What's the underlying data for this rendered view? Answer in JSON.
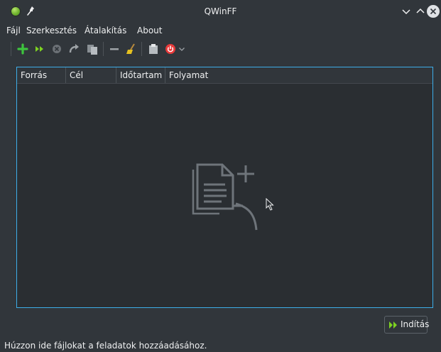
{
  "window": {
    "title": "QWinFF"
  },
  "menu": {
    "items": [
      {
        "label": "Fájl"
      },
      {
        "label": "Szerkesztés"
      },
      {
        "label": "Átalakítás"
      },
      {
        "label": "About"
      }
    ]
  },
  "toolbar": {
    "icons": [
      "add-file-icon",
      "fast-forward-icon",
      "cancel-icon",
      "redo-icon",
      "copy-icon",
      "remove-icon",
      "clear-list-icon",
      "paste-icon",
      "power-icon",
      "chevron-down-icon"
    ]
  },
  "tasklist": {
    "columns": [
      "Forrás",
      "Cél",
      "Időtartam",
      "Folyamat"
    ],
    "empty_icon": "drop-files-icon"
  },
  "actions": {
    "start_label": "Indítás"
  },
  "status": {
    "text": "Húzzon ide fájlokat a feladatok hozzáadásához."
  },
  "colors": {
    "background": "#31363b",
    "list_background": "#2a2e32",
    "accent": "#3daee9",
    "add_green": "#3ec43e",
    "power_red": "#e83a3a"
  }
}
